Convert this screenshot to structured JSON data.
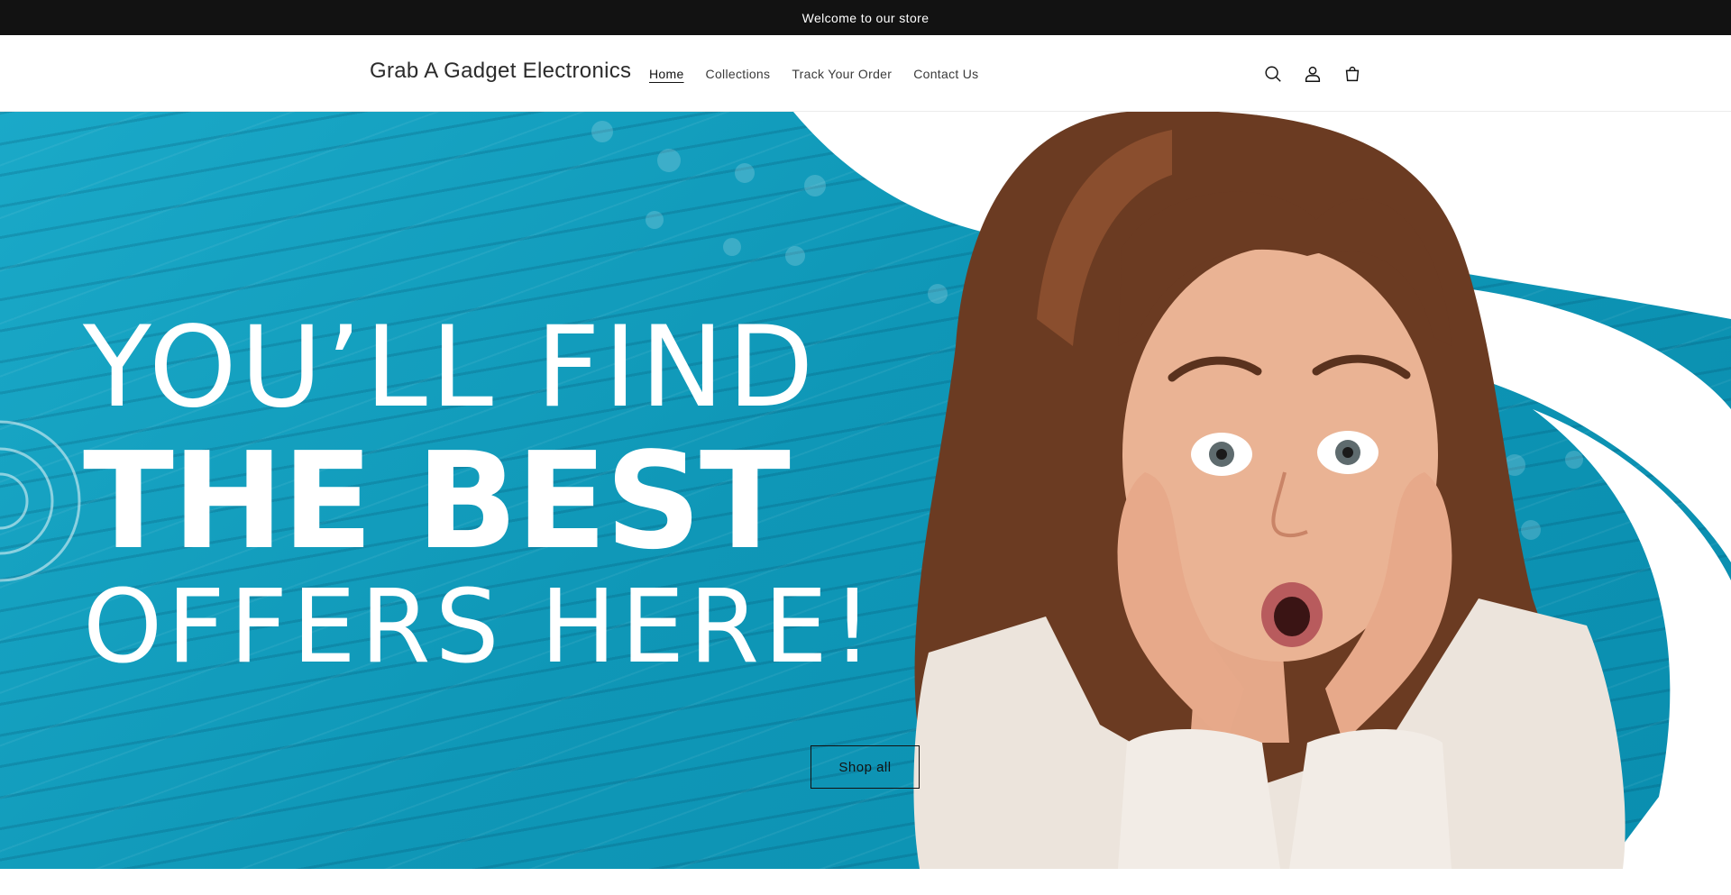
{
  "announcement": {
    "text": "Welcome to our store"
  },
  "header": {
    "logo": "Grab A Gadget Electronics",
    "nav": [
      {
        "label": "Home",
        "active": true
      },
      {
        "label": "Collections",
        "active": false
      },
      {
        "label": "Track Your Order",
        "active": false
      },
      {
        "label": "Contact Us",
        "active": false
      }
    ],
    "icons": [
      "search-icon",
      "account-icon",
      "cart-icon"
    ]
  },
  "hero": {
    "headline_line1": "YOU’LL FIND",
    "headline_line2": "THE BEST",
    "headline_line3": "OFFERS HERE!",
    "cta_label": "Shop all"
  },
  "colors": {
    "announcement_bg": "#121212",
    "hero_teal": "#0f97b7",
    "text_dark": "#121212"
  }
}
